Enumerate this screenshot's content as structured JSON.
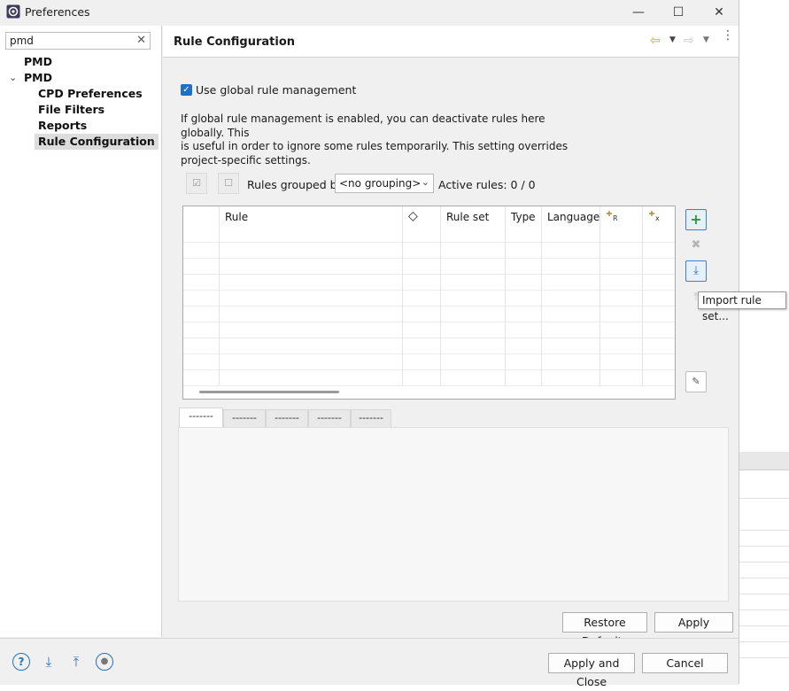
{
  "window": {
    "title": "Preferences"
  },
  "window_controls": {
    "minimize": "—",
    "maximize": "☐",
    "close": "✕"
  },
  "filter": {
    "value": "pmd",
    "clear": "✕"
  },
  "tree": {
    "items": [
      {
        "label": "PMD"
      },
      {
        "label": "PMD"
      },
      {
        "label": "CPD Preferences"
      },
      {
        "label": "File Filters"
      },
      {
        "label": "Reports"
      },
      {
        "label": "Rule Configuration"
      }
    ]
  },
  "page": {
    "title": "Rule Configuration",
    "checkbox_label": "Use global rule management",
    "description_lines": [
      "If global rule management is enabled, you can deactivate rules here globally. This",
      "is useful in order to ignore some rules temporarily. This setting overrides",
      "project-specific settings."
    ],
    "grouped_by_label": "Rules grouped by",
    "grouping_value": "<no grouping>",
    "active_rules": "Active rules: 0 / 0"
  },
  "table": {
    "columns": [
      "",
      "Rule",
      "◇",
      "Rule set",
      "Type",
      "Language",
      "",
      ""
    ]
  },
  "tooltip": {
    "text": "Import rule set..."
  },
  "tabs": [
    "-------",
    "-------",
    "-------",
    "-------",
    "-------"
  ],
  "buttons": {
    "restore_defaults": "Restore Defaults",
    "apply": "Apply",
    "apply_and_close": "Apply and Close",
    "cancel": "Cancel"
  },
  "colors": {
    "accent": "#1f6fc5",
    "selection": "#dddddd",
    "nav_arrow": "#c9a23a"
  }
}
